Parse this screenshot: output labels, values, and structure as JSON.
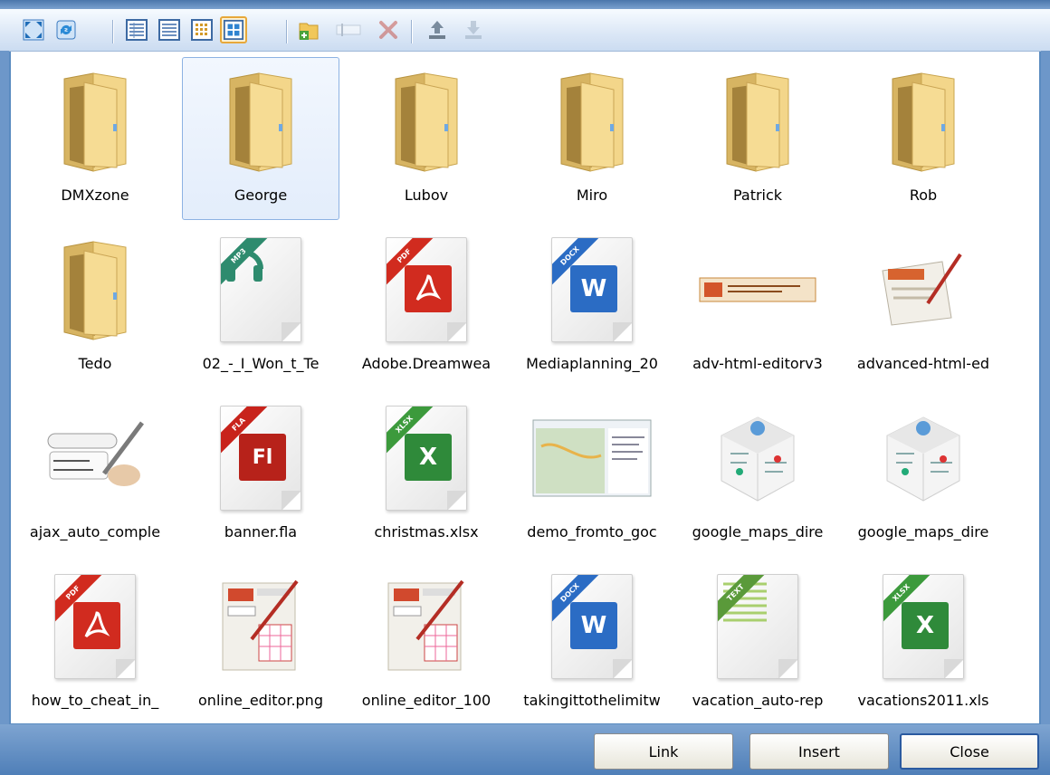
{
  "toolbar": {
    "buttons": [
      {
        "name": "fullscreen-icon",
        "state": "normal"
      },
      {
        "name": "refresh-icon",
        "state": "normal"
      },
      {
        "name": "details-view-icon",
        "state": "normal"
      },
      {
        "name": "list-view-icon",
        "state": "normal"
      },
      {
        "name": "small-icons-view-icon",
        "state": "normal"
      },
      {
        "name": "thumbnails-view-icon",
        "state": "active"
      },
      {
        "name": "new-folder-icon",
        "state": "normal"
      },
      {
        "name": "rename-icon",
        "state": "disabled"
      },
      {
        "name": "delete-icon",
        "state": "disabled"
      },
      {
        "name": "upload-icon",
        "state": "normal"
      },
      {
        "name": "download-icon",
        "state": "disabled"
      }
    ]
  },
  "items": [
    {
      "label": "DMXzone",
      "type": "folder"
    },
    {
      "label": "George",
      "type": "folder",
      "selected": true
    },
    {
      "label": "Lubov",
      "type": "folder"
    },
    {
      "label": "Miro",
      "type": "folder"
    },
    {
      "label": "Patrick",
      "type": "folder"
    },
    {
      "label": "Rob",
      "type": "folder"
    },
    {
      "label": "Tedo",
      "type": "folder"
    },
    {
      "label": "02_-_I_Won_t_Te",
      "type": "file",
      "badge": "MP3",
      "badge_color": "#2e8b6e",
      "icon": "headphones-icon"
    },
    {
      "label": "Adobe.Dreamwea",
      "type": "file",
      "badge": "PDF",
      "badge_color": "#d12b1f",
      "icon": "pdf-icon"
    },
    {
      "label": "Mediaplanning_20",
      "type": "file",
      "badge": "DOCX",
      "badge_color": "#2b6cc4",
      "icon": "word-icon"
    },
    {
      "label": "adv-html-editorv3",
      "type": "image",
      "icon": "banner-thumbnail"
    },
    {
      "label": "advanced-html-ed",
      "type": "image",
      "icon": "html-editor-thumbnail"
    },
    {
      "label": "ajax_auto_comple",
      "type": "image",
      "icon": "ajax-autocomplete-thumbnail"
    },
    {
      "label": "banner.fla",
      "type": "file",
      "badge": "FLA",
      "badge_color": "#c8231b",
      "icon": "flash-icon"
    },
    {
      "label": "christmas.xlsx",
      "type": "file",
      "badge": "XLSX",
      "badge_color": "#3c9a3c",
      "icon": "excel-icon"
    },
    {
      "label": "demo_fromto_goc",
      "type": "image",
      "icon": "map-screenshot-thumbnail"
    },
    {
      "label": "google_maps_dire",
      "type": "image",
      "icon": "maps-cube-thumbnail"
    },
    {
      "label": "google_maps_dire",
      "type": "image",
      "icon": "maps-cube-thumbnail"
    },
    {
      "label": "how_to_cheat_in_",
      "type": "file",
      "badge": "PDF",
      "badge_color": "#d12b1f",
      "icon": "pdf-icon"
    },
    {
      "label": "online_editor.png",
      "type": "image",
      "icon": "online-editor-thumbnail"
    },
    {
      "label": "online_editor_100",
      "type": "image",
      "icon": "online-editor-thumbnail"
    },
    {
      "label": "takingittothelimitw",
      "type": "file",
      "badge": "DOCX",
      "badge_color": "#2b6cc4",
      "icon": "word-icon"
    },
    {
      "label": "vacation_auto-rep",
      "type": "file",
      "badge": "TEXT",
      "badge_color": "#5a9a3a",
      "icon": "text-lines-icon"
    },
    {
      "label": "vacations2011.xls",
      "type": "file",
      "badge": "XLSX",
      "badge_color": "#3c9a3c",
      "icon": "excel-icon"
    }
  ],
  "buttons": {
    "link": "Link",
    "insert": "Insert",
    "close": "Close"
  }
}
